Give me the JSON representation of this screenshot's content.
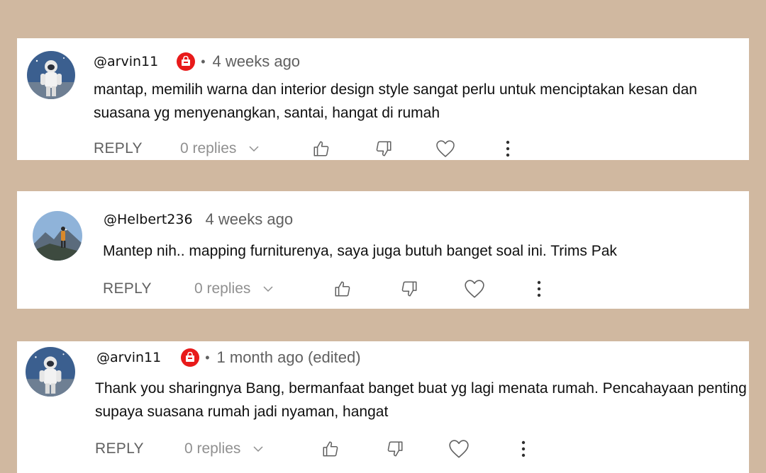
{
  "comments": [
    {
      "handle": "@arvin11",
      "has_badge": true,
      "separator": "•",
      "time": "4 weeks ago",
      "text": "mantap, memilih warna dan interior design style sangat perlu untuk menciptakan kesan dan suasana yg menyenangkan, santai, hangat di rumah",
      "reply_label": "REPLY",
      "replies_label": "0 replies",
      "avatar": "astronaut-avatar"
    },
    {
      "handle": "@Helbert236",
      "has_badge": false,
      "time": "4 weeks ago",
      "text": "Mantep nih.. mapping furniturenya, saya juga butuh banget soal ini. Trims Pak",
      "reply_label": "REPLY",
      "replies_label": "0 replies",
      "avatar": "mountain-hiker-avatar"
    },
    {
      "handle": "@arvin11",
      "has_badge": true,
      "separator": "•",
      "time": "1 month ago (edited)",
      "text": "Thank you sharingnya Bang, bermanfaat banget buat yg lagi menata rumah. Pencahayaan penting supaya suasana rumah jadi nyaman, hangat",
      "reply_label": "REPLY",
      "replies_label": "0 replies",
      "avatar": "astronaut-avatar"
    }
  ],
  "colors": {
    "background": "#d0b8a0",
    "card": "#ffffff",
    "badge": "#e81a1a",
    "secondary_text": "#606060"
  },
  "icons": [
    "chevron-down-icon",
    "thumbs-up-icon",
    "thumbs-down-icon",
    "heart-icon",
    "more-vert-icon",
    "store-badge-icon"
  ]
}
